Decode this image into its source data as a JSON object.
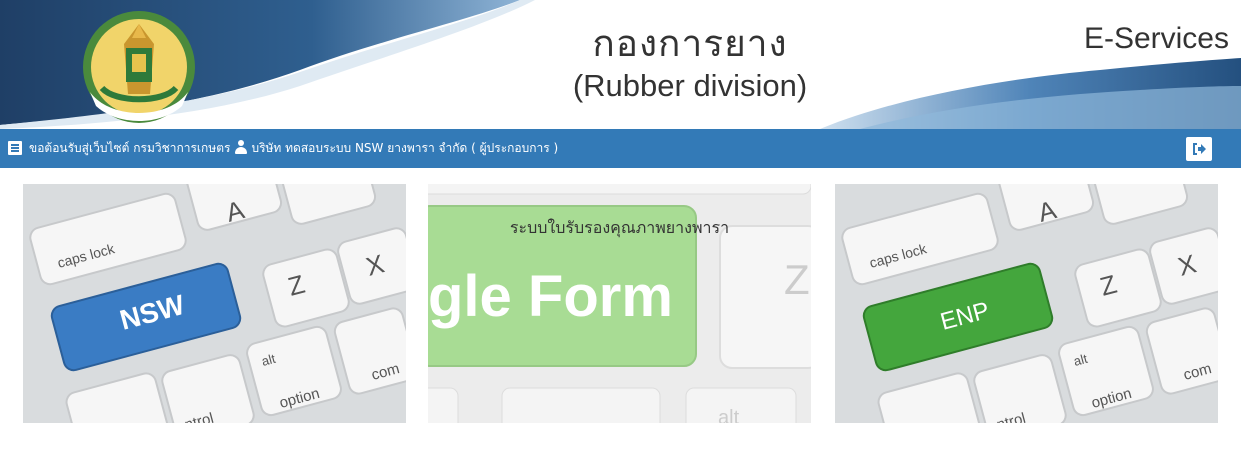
{
  "header": {
    "title_th": "กองการยาง",
    "title_en": "(Rubber division)",
    "eservices": "E-Services",
    "logo_text": "กรมวิชาการเกษตร"
  },
  "navbar": {
    "welcome_text": "ขอต้อนรับสู่เว็บไซต์ กรมวิชาการเกษตร",
    "user_text": "บริษัท ทดสอบระบบ NSW ยางพารา จำกัด ( ผู้ประกอบการ )"
  },
  "cards": [
    {
      "key_label": "NSW",
      "key_color": "#3a7cc4",
      "caption": ""
    },
    {
      "key_label": "gle Form",
      "key_color": "#a8dc94",
      "caption": "ระบบใบรับรองคุณภาพยางพารา"
    },
    {
      "key_label": "ENP",
      "key_color": "#44a63d",
      "caption": ""
    }
  ],
  "keyboard_labels": {
    "caps": "caps lock",
    "a": "A",
    "z": "Z",
    "x": "X",
    "alt": "alt",
    "option": "option",
    "control": "control",
    "com": "com"
  },
  "icons": {
    "menu": "menu-icon",
    "user": "user-icon",
    "logout": "sign-out-icon"
  },
  "colors": {
    "navbar": "#337ab7",
    "header_wave": "#2c5d8f"
  }
}
